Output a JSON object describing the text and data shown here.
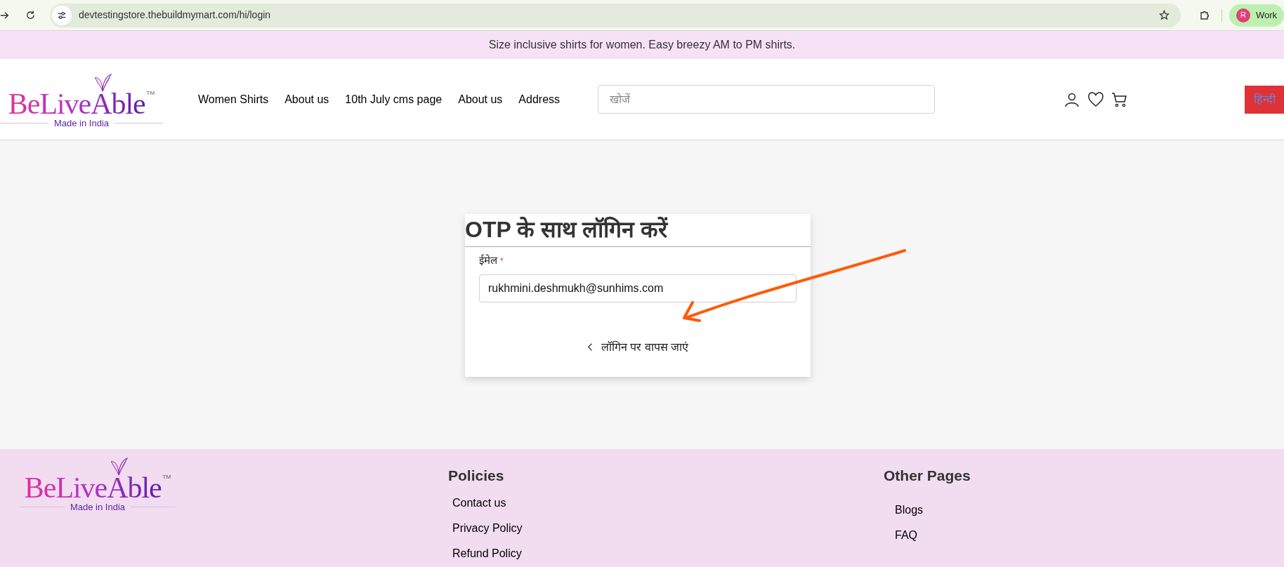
{
  "browser": {
    "url": "devtestingstore.thebuildmymart.com/hi/login",
    "profile": {
      "initial": "R",
      "label": "Work"
    }
  },
  "announcement": "Size inclusive shirts for women. Easy breezy AM to PM shirts.",
  "header": {
    "logo": {
      "name": "BeLiveAble",
      "trademark": "TM",
      "tagline": "Made in India"
    },
    "nav": [
      "Women Shirts",
      "About us",
      "10th July cms page",
      "About us",
      "Address"
    ],
    "search": {
      "placeholder": "खोजें"
    },
    "language_button": "हिन्दी"
  },
  "login_card": {
    "title": "OTP के साथ लॉगिन करें",
    "email_field": {
      "label": "ईमेल",
      "required_mark": "*",
      "value": "rukhmini.deshmukh@sunhims.com"
    },
    "back_link": "लॉगिन पर वापस जाएं"
  },
  "footer": {
    "logo": {
      "name": "BeLiveAble",
      "trademark": "TM",
      "tagline": "Made in India"
    },
    "columns": [
      {
        "heading": "Policies",
        "links": [
          "Contact us",
          "Privacy Policy",
          "Refund Policy"
        ]
      },
      {
        "heading": "Other Pages",
        "links": [
          "Blogs",
          "FAQ"
        ]
      }
    ]
  }
}
